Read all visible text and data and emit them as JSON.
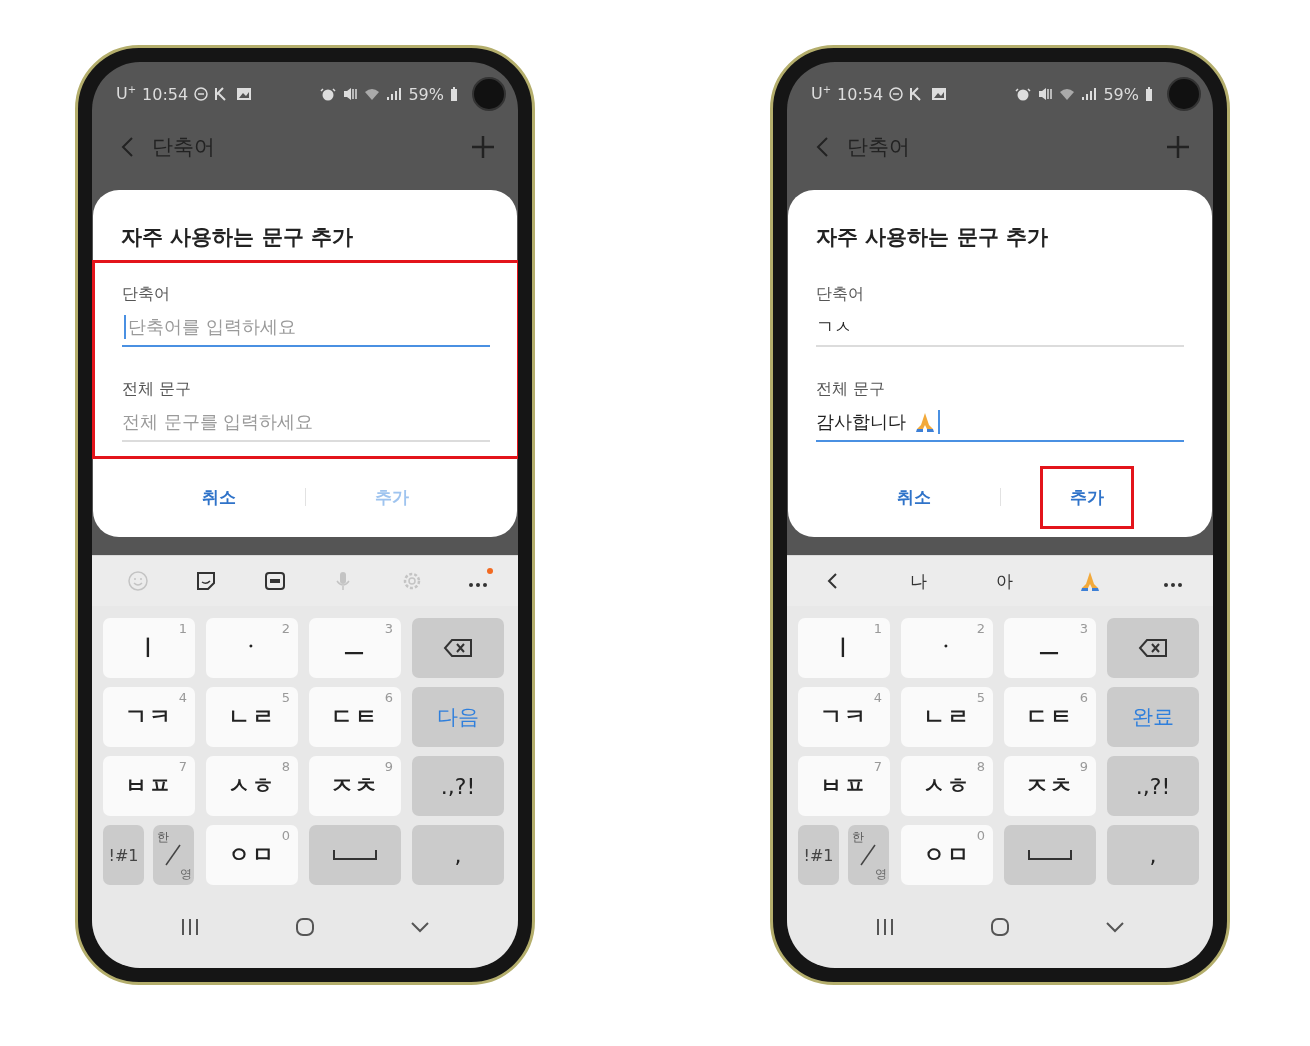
{
  "phones": [
    {
      "status_bar": {
        "carrier": "U$^{+}$",
        "time": "10:54",
        "battery": "59%"
      },
      "app_bar": {
        "title": "단축어"
      },
      "dialog": {
        "title": "자주 사용하는 문구 추가",
        "fields_highlighted": true,
        "fields": [
          {
            "label": "단축어",
            "placeholder": "단축어를 입력하세요",
            "focused": true
          },
          {
            "label": "전체 문구",
            "placeholder": "전체 문구를 입력하세요",
            "focused": false
          }
        ],
        "buttons": [
          {
            "label": "취소",
            "disabled": false,
            "highlighted": false
          },
          {
            "label": "추가",
            "disabled": true,
            "highlighted": false
          }
        ]
      },
      "keyboard": {
        "toolbar": [
          {
            "kind": "emoji",
            "disabled": true
          },
          {
            "kind": "sticker",
            "disabled": false
          },
          {
            "kind": "gif",
            "disabled": false
          },
          {
            "kind": "mic",
            "disabled": true
          },
          {
            "kind": "settings",
            "disabled": true
          },
          {
            "kind": "more",
            "badge": true
          }
        ],
        "rows": [
          [
            {
              "kind": "char",
              "label": "ㅣ",
              "number": "1"
            },
            {
              "kind": "char",
              "label": "ㆍ",
              "number": "2"
            },
            {
              "kind": "char",
              "label": "ㅡ",
              "number": "3"
            },
            {
              "kind": "backspace"
            }
          ],
          [
            {
              "kind": "char",
              "label": "ㄱㅋ",
              "number": "4"
            },
            {
              "kind": "char",
              "label": "ㄴㄹ",
              "number": "5"
            },
            {
              "kind": "char",
              "label": "ㄷㅌ",
              "number": "6"
            },
            {
              "kind": "enter",
              "label": "다음"
            }
          ],
          [
            {
              "kind": "char",
              "label": "ㅂㅍ",
              "number": "7"
            },
            {
              "kind": "char",
              "label": "ㅅㅎ",
              "number": "8"
            },
            {
              "kind": "char",
              "label": "ㅈㅊ",
              "number": "9"
            },
            {
              "kind": "func",
              "label": ".,?!"
            }
          ],
          [
            {
              "kind": "pair",
              "keys": [
                {
                  "kind": "small",
                  "label": "!#1"
                },
                {
                  "kind": "lang",
                  "label": "한",
                  "sub": "영"
                }
              ]
            },
            {
              "kind": "char",
              "label": "ㅇㅁ",
              "number": "0"
            },
            {
              "kind": "space"
            },
            {
              "kind": "func",
              "label": ","
            }
          ]
        ]
      }
    },
    {
      "status_bar": {
        "carrier": "U$^{+}$",
        "time": "10:54",
        "battery": "59%"
      },
      "app_bar": {
        "title": "단축어"
      },
      "dialog": {
        "title": "자주 사용하는 문구 추가",
        "fields_highlighted": false,
        "fields": [
          {
            "label": "단축어",
            "value": "ㄱㅅ",
            "focused": false
          },
          {
            "label": "전체 문구",
            "value": "감사합니다",
            "trailing_emoji": true,
            "focused": true
          }
        ],
        "buttons": [
          {
            "label": "취소",
            "disabled": false,
            "highlighted": false
          },
          {
            "label": "추가",
            "disabled": false,
            "highlighted": true
          }
        ]
      },
      "keyboard": {
        "toolbar": [
          {
            "kind": "back"
          },
          {
            "kind": "word",
            "label": "나"
          },
          {
            "kind": "word",
            "label": "아"
          },
          {
            "kind": "emoji_suggestion"
          },
          {
            "kind": "more",
            "badge": false
          }
        ],
        "rows": [
          [
            {
              "kind": "char",
              "label": "ㅣ",
              "number": "1"
            },
            {
              "kind": "char",
              "label": "ㆍ",
              "number": "2"
            },
            {
              "kind": "char",
              "label": "ㅡ",
              "number": "3"
            },
            {
              "kind": "backspace"
            }
          ],
          [
            {
              "kind": "char",
              "label": "ㄱㅋ",
              "number": "4"
            },
            {
              "kind": "char",
              "label": "ㄴㄹ",
              "number": "5"
            },
            {
              "kind": "char",
              "label": "ㄷㅌ",
              "number": "6"
            },
            {
              "kind": "enter",
              "label": "완료"
            }
          ],
          [
            {
              "kind": "char",
              "label": "ㅂㅍ",
              "number": "7"
            },
            {
              "kind": "char",
              "label": "ㅅㅎ",
              "number": "8"
            },
            {
              "kind": "char",
              "label": "ㅈㅊ",
              "number": "9"
            },
            {
              "kind": "func",
              "label": ".,?!"
            }
          ],
          [
            {
              "kind": "pair",
              "keys": [
                {
                  "kind": "small",
                  "label": "!#1"
                },
                {
                  "kind": "lang",
                  "label": "한",
                  "sub": "영"
                }
              ]
            },
            {
              "kind": "char",
              "label": "ㅇㅁ",
              "number": "0"
            },
            {
              "kind": "space"
            },
            {
              "kind": "func",
              "label": ","
            }
          ]
        ]
      }
    }
  ]
}
